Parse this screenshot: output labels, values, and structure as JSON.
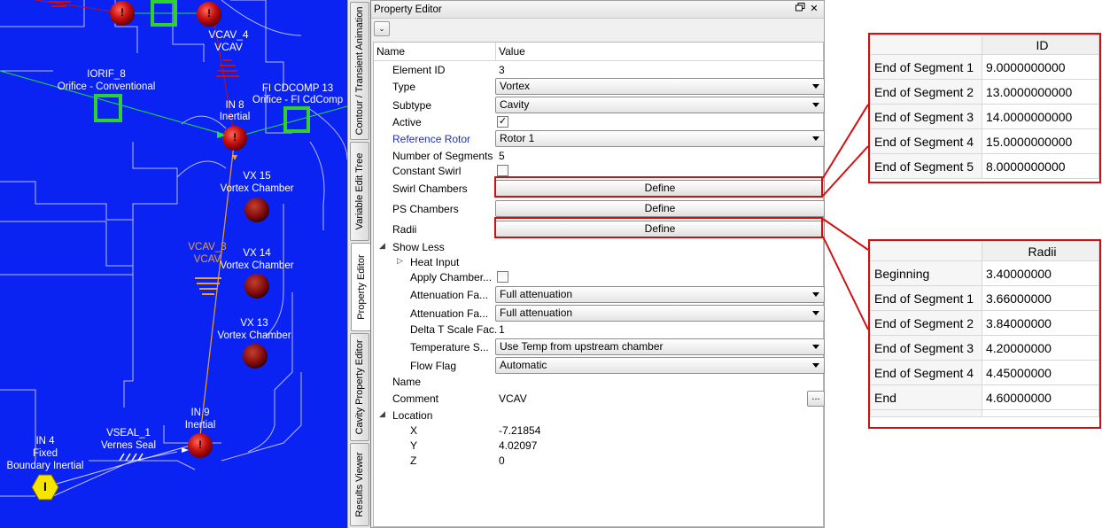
{
  "canvas": {
    "background": "#0a22f2",
    "labels": {
      "vcav4": "VCAV_4",
      "vcav4_type": "VCAV",
      "iorif8": "IORIF_8",
      "iorif8_type": "Orifice - Conventional",
      "ficdcomp13": "FI CDCOMP 13",
      "ficdcomp13_type": "Orifice - FI CdComp",
      "in8": "IN 8",
      "in8_type": "Inertial",
      "vx15": "VX 15",
      "vx15_type": "Vortex Chamber",
      "vcav3": "VCAV_3",
      "vcav3_type": "VCAV",
      "vx14": "VX 14",
      "vx14_type": "Vortex Chamber",
      "vx13": "VX 13",
      "vx13_type": "Vortex Chamber",
      "in9": "IN 9",
      "in9_type": "Inertial",
      "vseal1": "VSEAL_1",
      "vseal1_type": "Vernes Seal",
      "in4": "IN 4",
      "in4_type1": "Fixed",
      "in4_type2": "Boundary Inertial",
      "node_glyph_red": "!",
      "node_glyph_yellow": "I"
    }
  },
  "tabs": [
    "Contour / Transient Animation",
    "Variable Edit Tree",
    "Property Editor",
    "Cavity Property Editor",
    "Results Viewer"
  ],
  "panel": {
    "title": "Property Editor",
    "restore_icon": "restore-icon",
    "close_glyph": "✕",
    "toolbar_glyph": "⌄",
    "col_name": "Name",
    "col_value": "Value"
  },
  "props": {
    "element_id": {
      "k": "Element ID",
      "v": "3"
    },
    "type": {
      "k": "Type",
      "v": "Vortex"
    },
    "subtype": {
      "k": "Subtype",
      "v": "Cavity"
    },
    "active": {
      "k": "Active",
      "check": "✓"
    },
    "ref_rotor": {
      "k": "Reference Rotor",
      "v": "Rotor 1"
    },
    "num_segments": {
      "k": "Number of Segments",
      "v": "5"
    },
    "constant_swirl": {
      "k": "Constant Swirl"
    },
    "swirl_chambers": {
      "k": "Swirl Chambers",
      "btn": "Define"
    },
    "ps_chambers": {
      "k": "PS Chambers",
      "btn": "Define"
    },
    "radii": {
      "k": "Radii",
      "btn": "Define"
    },
    "show_less": {
      "k": "Show Less"
    },
    "heat_input": {
      "k": "Heat Input"
    },
    "apply_chamber": {
      "k": "Apply Chamber..."
    },
    "atten1": {
      "k": "Attenuation Fa...",
      "v": "Full attenuation"
    },
    "atten2": {
      "k": "Attenuation Fa...",
      "v": "Full attenuation"
    },
    "delta_t": {
      "k": "Delta T Scale Fac.",
      "v": "1"
    },
    "temp_s": {
      "k": "Temperature S...",
      "v": "Use Temp from upstream chamber"
    },
    "flow_flag": {
      "k": "Flow Flag",
      "v": "Automatic"
    },
    "name": {
      "k": "Name",
      "v": ""
    },
    "comment": {
      "k": "Comment",
      "v": "VCAV",
      "btn": "..."
    },
    "location": {
      "k": "Location"
    },
    "x": {
      "k": "X",
      "v": "-7.21854"
    },
    "y": {
      "k": "Y",
      "v": "4.02097"
    },
    "z": {
      "k": "Z",
      "v": "0"
    }
  },
  "callout_id": {
    "header": "ID",
    "rows": [
      {
        "label": "End of Segment 1",
        "value": "9.0000000000"
      },
      {
        "label": "End of Segment 2",
        "value": "13.0000000000"
      },
      {
        "label": "End of Segment 3",
        "value": "14.0000000000"
      },
      {
        "label": "End of Segment 4",
        "value": "15.0000000000"
      },
      {
        "label": "End of Segment 5",
        "value": "8.0000000000"
      }
    ]
  },
  "callout_radii": {
    "header": "Radii",
    "rows": [
      {
        "label": "Beginning",
        "value": "3.40000000"
      },
      {
        "label": "End of Segment 1",
        "value": "3.66000000"
      },
      {
        "label": "End of Segment 2",
        "value": "3.84000000"
      },
      {
        "label": "End of Segment 3",
        "value": "4.20000000"
      },
      {
        "label": "End of Segment 4",
        "value": "4.45000000"
      },
      {
        "label": "End",
        "value": "4.60000000"
      }
    ]
  },
  "colors": {
    "highlight": "#d01010",
    "node_red": "#c81010",
    "node_yellow": "#f5e600",
    "node_green": "#30d030",
    "flow_orange": "#f0a030"
  }
}
